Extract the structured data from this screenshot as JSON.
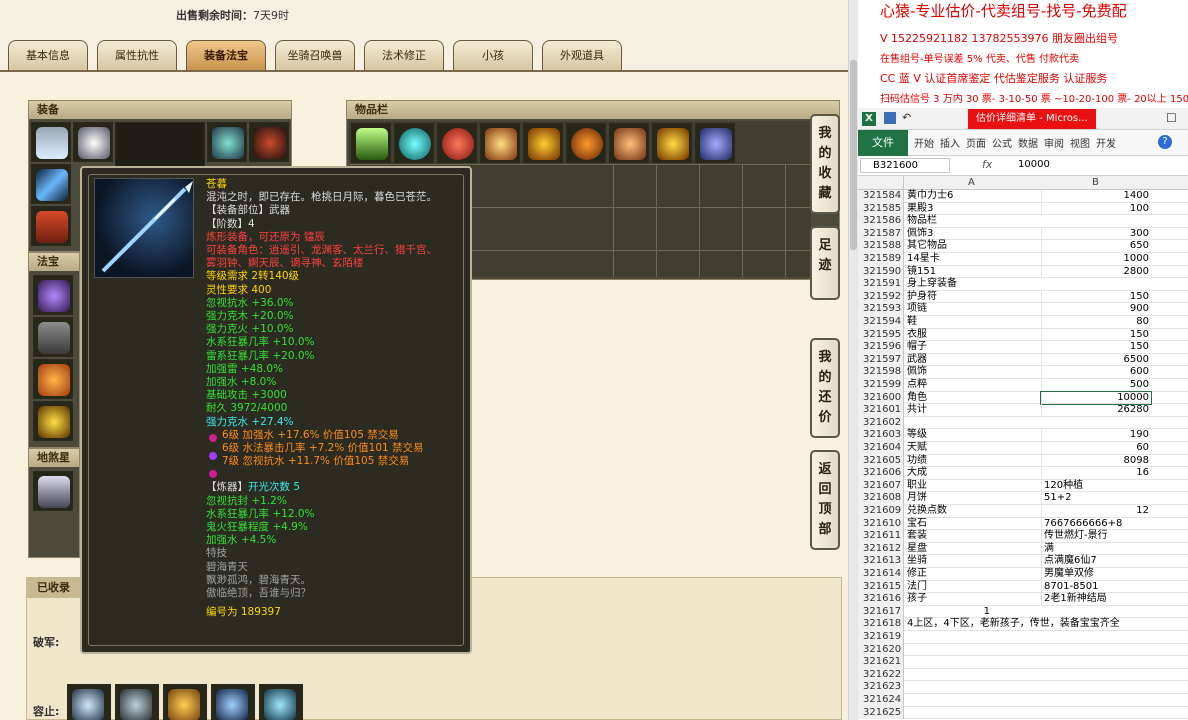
{
  "sale_time": {
    "label": "出售剩余时间：",
    "value": "7天9时"
  },
  "tabs": [
    "基本信息",
    "属性抗性",
    "装备法宝",
    "坐骑召唤兽",
    "法术修正",
    "小孩",
    "外观道具"
  ],
  "panels": {
    "equip": "装备",
    "fabao": "法宝",
    "bag": "物品栏",
    "dihun": "地煞星",
    "collected": "已收录"
  },
  "side_buttons": [
    [
      "我",
      "的",
      "收",
      "藏"
    ],
    [
      "足",
      "迹"
    ],
    [
      "我",
      "的",
      "还",
      "价"
    ],
    [
      "返",
      "回",
      "顶",
      "部"
    ]
  ],
  "collected_labels": {
    "pojun": "破军:",
    "rongzhi": "容止:"
  },
  "tooltip": {
    "name": "苍暮",
    "desc": "混沌之时，即已存在。枪挑日月际，暮色已苍茫。",
    "slot": "【装备部位】武器",
    "tier": "【阶数】4",
    "bind": "炼形装备，可还原为 镭辰",
    "roles": "可装备角色：逍遥引、龙渊客、太兰行、猎千宫、",
    "roles2": "雾羽钟、婀天辰、谪寻神、玄陌楼",
    "level_req": "等级需求 2转140级",
    "spirit_req": "灵性要求 400",
    "stats": [
      "忽视抗水 +36.0%",
      "强力克木 +20.0%",
      "强力克火 +10.0%",
      "水系狂暴几率 +10.0%",
      "雷系狂暴几率 +20.0%",
      "加强雷 +48.0%",
      "加强水 +8.0%",
      "基础攻击 +3000",
      "耐久 3972/4000"
    ],
    "cyan_stat": "强力克水 +27.4%",
    "gems": [
      "6级 加强水 +17.6% 价值105 禁交易",
      "6级 水法暴击几率 +7.2% 价值101 禁交易",
      "7级 忽视抗水 +11.7% 价值105 禁交易"
    ],
    "refine_head": "【炼器】",
    "refine_count": "开光次数 5",
    "refine": [
      "忽视抗封 +1.2%",
      "水系狂暴几率 +12.0%",
      "鬼火狂暴程度 +4.9%",
      "加强水 +4.5%"
    ],
    "special_head": "特技",
    "special": "碧海青天",
    "special_desc": "飘渺孤鸿，碧海青天。",
    "special_desc2": "傲临绝顶，吾谁与归？",
    "serial": "编号为 189397"
  },
  "banner": {
    "title": "心猿-专业估价-代卖组号-找号-免费配",
    "line1": "V 15225921182   13782553976 朋友圈出组号",
    "line2": "在售组号-单号误差 5%  代卖、代售 付款代卖",
    "line3": "CC 蓝 V 认证首席鉴定 代估鉴定服务 认证服务",
    "line4": "扫码估信号 3 万内 30 票- 3-10-50 票  ~10-20-100 票- 20以上 150"
  },
  "excel": {
    "title": "估价详细清单 - Micros...",
    "tabs": [
      "文件",
      "开始",
      "插入",
      "页面",
      "公式",
      "数据",
      "审阅",
      "视图",
      "开发"
    ],
    "namebox": "B321600",
    "formula": "10000",
    "columns": [
      "A",
      "B"
    ],
    "rows": [
      [
        "321584",
        "黄巾力士6",
        "1400"
      ],
      [
        "321585",
        "果殿3",
        "100"
      ],
      [
        "321586",
        "物品栏",
        ""
      ],
      [
        "321587",
        "佩饰3",
        "300"
      ],
      [
        "321588",
        "其它物品",
        "650"
      ],
      [
        "321589",
        "14星卡",
        "1000"
      ],
      [
        "321590",
        "镜151",
        "2800"
      ],
      [
        "321591",
        "身上穿装备",
        ""
      ],
      [
        "321592",
        "护身符",
        "150"
      ],
      [
        "321593",
        "项链",
        "900"
      ],
      [
        "321594",
        "鞋",
        "80"
      ],
      [
        "321595",
        "衣服",
        "150"
      ],
      [
        "321596",
        "帽子",
        "150"
      ],
      [
        "321597",
        "武器",
        "6500"
      ],
      [
        "321598",
        "佩饰",
        "600"
      ],
      [
        "321599",
        "点粹",
        "500"
      ],
      [
        "321600",
        "角色",
        "10000"
      ],
      [
        "321601",
        "共计",
        "26280"
      ],
      [
        "321602",
        "",
        ""
      ],
      [
        "321603",
        "等级",
        "190"
      ],
      [
        "321604",
        "天赋",
        "60"
      ],
      [
        "321605",
        "功绩",
        "8098"
      ],
      [
        "321606",
        "大成",
        "16"
      ],
      [
        "321607",
        "职业",
        "120种植"
      ],
      [
        "321608",
        "月饼",
        "51+2"
      ],
      [
        "321609",
        "兑换点数",
        "12"
      ],
      [
        "321610",
        "宝石",
        "7667666666+8"
      ],
      [
        "321611",
        "套装",
        "传世燃灯-景行"
      ],
      [
        "321612",
        "星盘",
        "满"
      ],
      [
        "321613",
        "坐骑",
        "点满魔6仙7"
      ],
      [
        "321614",
        "修正",
        "男魔单双修"
      ],
      [
        "321615",
        "法门",
        "8701-8501"
      ],
      [
        "321616",
        "孩子",
        "2老1新神结局"
      ],
      [
        "321617",
        "1",
        ""
      ],
      [
        "321618",
        "4上区，4下区，老新孩子，传世，装备宝宝齐全",
        ""
      ],
      [
        "321619",
        "",
        ""
      ],
      [
        "321620",
        "",
        ""
      ],
      [
        "321621",
        "",
        ""
      ],
      [
        "321622",
        "",
        ""
      ],
      [
        "321623",
        "",
        ""
      ],
      [
        "321624",
        "",
        ""
      ],
      [
        "321625",
        "",
        ""
      ]
    ]
  }
}
